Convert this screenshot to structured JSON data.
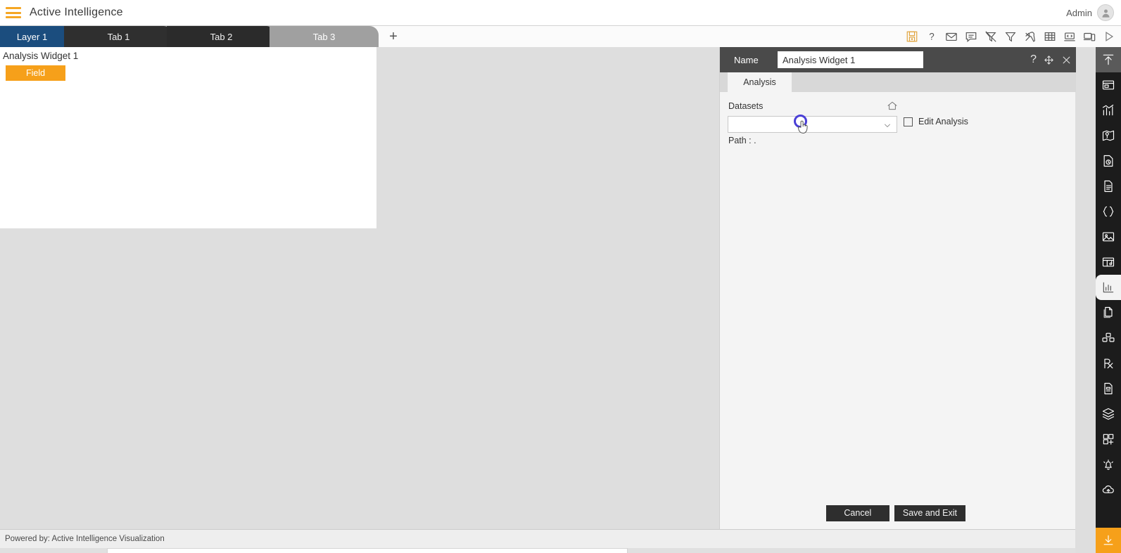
{
  "app": {
    "brand": "Active Intelligence",
    "menu_icon": "hamburger-icon",
    "user_label": "Admin",
    "avatar_icon": "user-avatar-icon"
  },
  "tabs": {
    "layer_label": "Layer 1",
    "items": [
      {
        "label": "Tab 1",
        "active": false
      },
      {
        "label": "Tab 2",
        "active": false
      },
      {
        "label": "Tab 3",
        "active": true
      }
    ],
    "add_label": "+"
  },
  "toolbar": {
    "icons": [
      {
        "name": "save-disk-icon",
        "title": "Save"
      },
      {
        "name": "help-question-icon",
        "title": "Help"
      },
      {
        "name": "mail-envelope-icon",
        "title": "Mail"
      },
      {
        "name": "comment-bubble-icon",
        "title": "Comment"
      },
      {
        "name": "clear-filter-icon",
        "title": "Clear Filter"
      },
      {
        "name": "filter-funnel-icon",
        "title": "Filter"
      },
      {
        "name": "tools-wrench-icon",
        "title": "Tools"
      },
      {
        "name": "table-grid-icon",
        "title": "Table"
      },
      {
        "name": "code-laptop-icon",
        "title": "Code"
      },
      {
        "name": "devices-responsive-icon",
        "title": "Devices"
      },
      {
        "name": "play-run-icon",
        "title": "Run"
      }
    ]
  },
  "canvas": {
    "widget_title": "Analysis Widget 1",
    "field_chip": "Field"
  },
  "dialog": {
    "name_label": "Name",
    "name_value": "Analysis Widget 1",
    "name_placeholder": "Name",
    "header_icons": [
      {
        "name": "help-question-icon",
        "glyph": "?"
      },
      {
        "name": "move-arrows-icon"
      },
      {
        "name": "close-x-icon"
      }
    ],
    "tab_label": "Analysis",
    "datasets_label": "Datasets",
    "home_icon": "home-icon",
    "dataset_value": "",
    "dataset_placeholder": "",
    "dropdown_icon": "chevron-down-icon",
    "edit_analysis_label": "Edit Analysis",
    "edit_analysis_checked": false,
    "path_label": "Path :  .",
    "cancel_label": "Cancel",
    "save_label": "Save and Exit"
  },
  "rail": {
    "items": [
      {
        "name": "rail-collapse-up-icon",
        "style": "top-arrow"
      },
      {
        "name": "rail-widget-panel-icon",
        "style": ""
      },
      {
        "name": "rail-chart-bar-icon",
        "style": ""
      },
      {
        "name": "rail-map-location-icon",
        "style": ""
      },
      {
        "name": "rail-report-clock-icon",
        "style": ""
      },
      {
        "name": "rail-document-icon",
        "style": ""
      },
      {
        "name": "rail-code-braces-icon",
        "style": ""
      },
      {
        "name": "rail-image-icon",
        "style": ""
      },
      {
        "name": "rail-media-grid-icon",
        "style": ""
      },
      {
        "name": "rail-analysis-chart-icon",
        "style": "active"
      },
      {
        "name": "rail-copy-pages-icon",
        "style": ""
      },
      {
        "name": "rail-cubes-icon",
        "style": ""
      },
      {
        "name": "rail-prescription-rx-icon",
        "style": ""
      },
      {
        "name": "rail-document-list-icon",
        "style": ""
      },
      {
        "name": "rail-layers-icon",
        "style": ""
      },
      {
        "name": "rail-add-widget-icon",
        "style": ""
      },
      {
        "name": "rail-alert-bell-icon",
        "style": ""
      },
      {
        "name": "rail-cloud-upload-icon",
        "style": ""
      },
      {
        "name": "rail-download-icon",
        "style": "download"
      }
    ]
  },
  "footer": {
    "text": "Powered by: Active Intelligence Visualization"
  },
  "colors": {
    "brand_orange": "#f6a01a",
    "layer_blue": "#1b4d7e",
    "tab_dark": "#2f2f2f",
    "tab_active_gray": "#a0a0a0",
    "dialog_header": "#4a4a4a",
    "rail_dark": "#1c1c1c",
    "cursor_ring": "#4a3fd6"
  }
}
